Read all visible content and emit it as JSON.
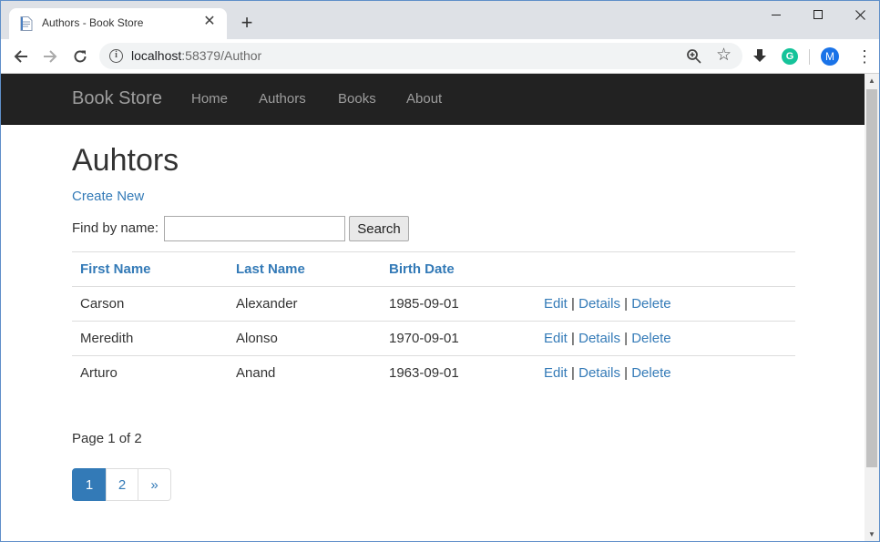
{
  "browser": {
    "tab_title": "Authors - Book Store",
    "url_host": "localhost",
    "url_rest": ":58379/Author",
    "avatar_letter": "M",
    "grammarly_letter": "G"
  },
  "navbar": {
    "brand": "Book Store",
    "links": [
      "Home",
      "Authors",
      "Books",
      "About"
    ]
  },
  "page": {
    "title": "Auhtors",
    "create_link": "Create New",
    "find_label": "Find by name:",
    "search_value": "",
    "search_button": "Search"
  },
  "table": {
    "headers": [
      "First Name",
      "Last Name",
      "Birth Date"
    ],
    "rows": [
      {
        "first": "Carson",
        "last": "Alexander",
        "birth": "1985-09-01"
      },
      {
        "first": "Meredith",
        "last": "Alonso",
        "birth": "1970-09-01"
      },
      {
        "first": "Arturo",
        "last": "Anand",
        "birth": "1963-09-01"
      }
    ],
    "actions": {
      "edit": "Edit",
      "details": "Details",
      "delete": "Delete",
      "separator": "|"
    }
  },
  "paging": {
    "info": "Page 1 of 2",
    "pages": [
      "1",
      "2"
    ],
    "next": "»",
    "current": 1
  },
  "colors": {
    "navbar_bg": "#222222",
    "link": "#337ab7",
    "active_page": "#337ab7"
  }
}
